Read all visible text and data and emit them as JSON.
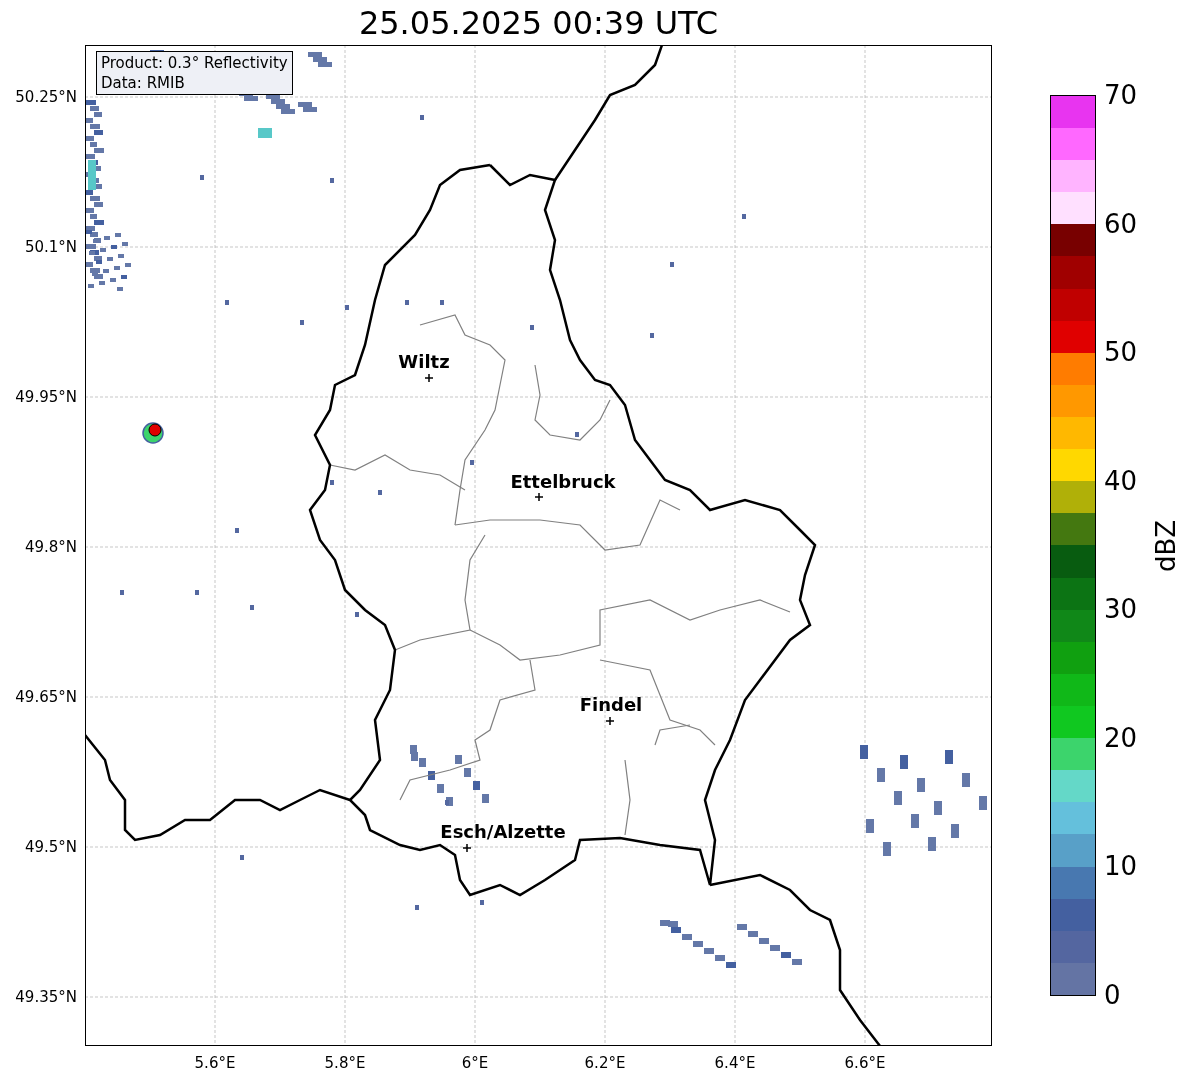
{
  "title": "25.05.2025 00:39 UTC",
  "info_box": {
    "lines": [
      "Product: 0.3° Reflectivity",
      "Data: RMIB"
    ]
  },
  "map": {
    "latitude_labels": [
      "50.25°N",
      "50.1°N",
      "49.95°N",
      "49.8°N",
      "49.65°N",
      "49.5°N",
      "49.35°N"
    ],
    "longitude_labels": [
      "5.6°E",
      "5.8°E",
      "6°E",
      "6.2°E",
      "6.4°E",
      "6.6°E"
    ],
    "cities": [
      {
        "name": "Wiltz"
      },
      {
        "name": "Ettelbruck"
      },
      {
        "name": "Findel"
      },
      {
        "name": "Esch/Alzette"
      }
    ]
  },
  "colorbar": {
    "label": "dBZ",
    "ticks": [
      "70",
      "60",
      "50",
      "40",
      "30",
      "20",
      "10",
      "0"
    ],
    "segments": [
      {
        "color": "#6474a4"
      },
      {
        "color": "#5466a0"
      },
      {
        "color": "#4460a0"
      },
      {
        "color": "#4878b0"
      },
      {
        "color": "#58a0c8"
      },
      {
        "color": "#64c0dc"
      },
      {
        "color": "#64d8c8"
      },
      {
        "color": "#3cd46c"
      },
      {
        "color": "#10c820"
      },
      {
        "color": "#10b818"
      },
      {
        "color": "#10a010"
      },
      {
        "color": "#108818"
      },
      {
        "color": "#0c7414"
      },
      {
        "color": "#085c10"
      },
      {
        "color": "#447810"
      },
      {
        "color": "#b0b008"
      },
      {
        "color": "#ffd800"
      },
      {
        "color": "#ffb800"
      },
      {
        "color": "#ff9800"
      },
      {
        "color": "#ff7c00"
      },
      {
        "color": "#e00000"
      },
      {
        "color": "#c00000"
      },
      {
        "color": "#a00000"
      },
      {
        "color": "#780000"
      },
      {
        "color": "#ffe0ff"
      },
      {
        "color": "#ffb4ff"
      },
      {
        "color": "#ff68ff"
      },
      {
        "color": "#e834f0"
      }
    ]
  }
}
